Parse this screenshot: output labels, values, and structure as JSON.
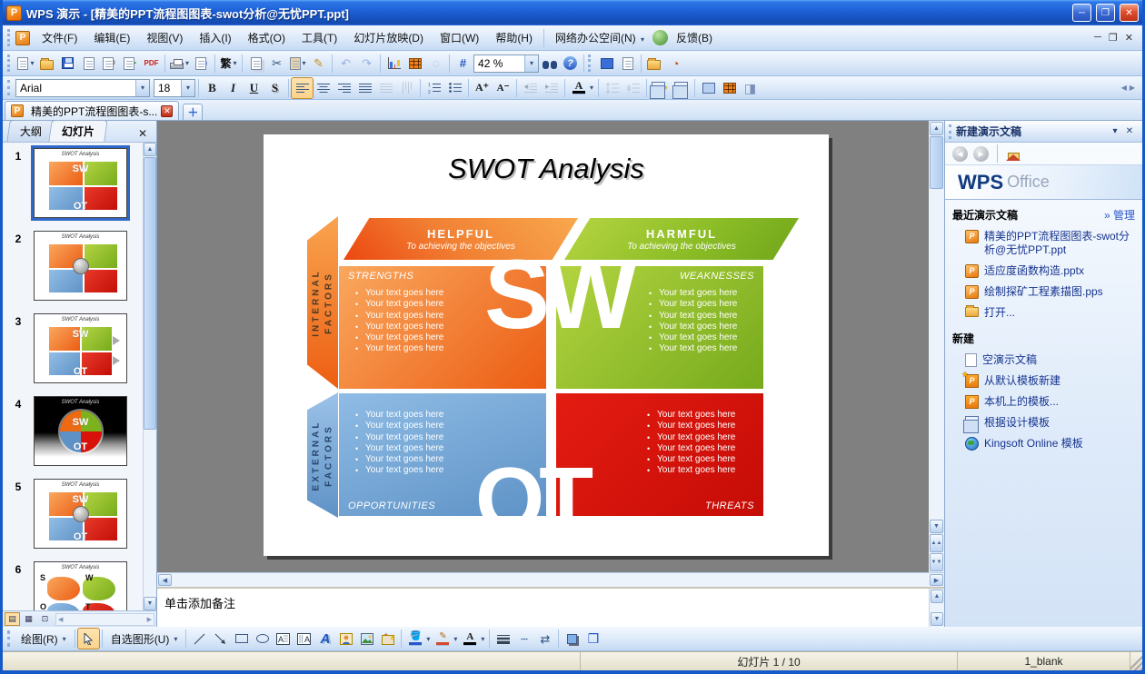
{
  "window": {
    "title": "WPS 演示 - [精美的PPT流程图图表-swot分析@无忧PPT.ppt]",
    "app_badge": "P"
  },
  "icons": {
    "minimize": "─",
    "maximize": "❐",
    "close": "✕",
    "dropdown": "▾",
    "up": "▲",
    "down": "▼",
    "left": "◀",
    "right": "▶",
    "prev_slide": "▲▲",
    "next_slide": "▼▼",
    "cut": "✂",
    "undo": "↶",
    "redo": "↷",
    "help": "?",
    "grid": "#",
    "plus_tab": "＋",
    "home": "⌂",
    "tab_close": "✕",
    "line": "╲",
    "arrow": "➘",
    "wordart": "A",
    "dash": "┄",
    "arrows2": "⇄",
    "shadow": "❏",
    "cube": "❒",
    "brush": "✎",
    "person": "👤"
  },
  "menu_bar": {
    "items": [
      "文件(F)",
      "编辑(E)",
      "视图(V)",
      "插入(I)",
      "格式(O)",
      "工具(T)",
      "幻灯片放映(D)",
      "窗口(W)",
      "帮助(H)"
    ],
    "net_office": "网络办公空间(N)",
    "feedback": "反馈(B)"
  },
  "standard_toolbar": {
    "traditional_label": "繁",
    "zoom_value": "42 %",
    "pdf_label": "PDF"
  },
  "format_toolbar": {
    "font_name": "Arial",
    "font_size": "18",
    "bold": "B",
    "italic": "I",
    "underline": "U",
    "strike": "S",
    "grow": "A⁺",
    "shrink": "A⁻",
    "font_color": "A"
  },
  "doc_tabs": {
    "active_label": "精美的PPT流程图图表-s..."
  },
  "left_panel": {
    "tabs": [
      "大纲",
      "幻灯片"
    ],
    "slide_numbers": [
      "1",
      "2",
      "3",
      "4",
      "5",
      "6"
    ],
    "thumb6_letters": [
      "S",
      "W",
      "O",
      "T"
    ]
  },
  "slide": {
    "title": "SWOT Analysis",
    "helpful": {
      "title": "HELPFUL",
      "subtitle": "To achieving the objectives"
    },
    "harmful": {
      "title": "HARMFUL",
      "subtitle": "To achieving the objectives"
    },
    "internal": {
      "line1": "INTERNAL",
      "line2": "FACTORS"
    },
    "external": {
      "line1": "EXTERNAL",
      "line2": "FACTORS"
    },
    "big_sw": "SW",
    "big_ot": "OT",
    "quadrants": {
      "strengths": {
        "label": "STRENGTHS",
        "bullets": [
          "Your text goes here",
          "Your text goes here",
          "Your text goes here",
          "Your text goes here",
          "Your text goes here",
          "Your text goes here"
        ]
      },
      "weaknesses": {
        "label": "WEAKNESSES",
        "bullets": [
          "Your text goes here",
          "Your text goes here",
          "Your text goes here",
          "Your text goes here",
          "Your text goes here",
          "Your text goes here"
        ]
      },
      "opportunities": {
        "label": "OPPORTUNITIES",
        "bullets": [
          "Your text goes here",
          "Your text goes here",
          "Your text goes here",
          "Your text goes here",
          "Your text goes here",
          "Your text goes here"
        ]
      },
      "threats": {
        "label": "THREATS",
        "bullets": [
          "Your text goes here",
          "Your text goes here",
          "Your text goes here",
          "Your text goes here",
          "Your text goes here",
          "Your text goes here"
        ]
      }
    },
    "colors": {
      "orange": "#EC5C13",
      "green": "#76AA1C",
      "blue": "#5E92C6",
      "red": "#D8120A"
    }
  },
  "notes": {
    "placeholder": "单击添加备注"
  },
  "task_pane": {
    "title": "新建演示文稿",
    "logo_wps": "WPS",
    "logo_office": "Office",
    "recent_heading": "最近演示文稿",
    "manage_link": "» 管理",
    "recent_items": [
      "精美的PPT流程图图表-swot分析@无忧PPT.ppt",
      "适应度函数构造.pptx",
      "绘制探矿工程素描图.pps"
    ],
    "open_item": "打开...",
    "new_heading": "新建",
    "new_items": [
      "空演示文稿",
      "从默认模板新建",
      "本机上的模板...",
      "根据设计模板",
      "Kingsoft Online 模板"
    ]
  },
  "drawing_toolbar": {
    "draw_label": "绘图(R)",
    "autoshapes_label": "自选图形(U)"
  },
  "status_bar": {
    "slide_indicator": "幻灯片 1 / 10",
    "template_name": "1_blank"
  }
}
